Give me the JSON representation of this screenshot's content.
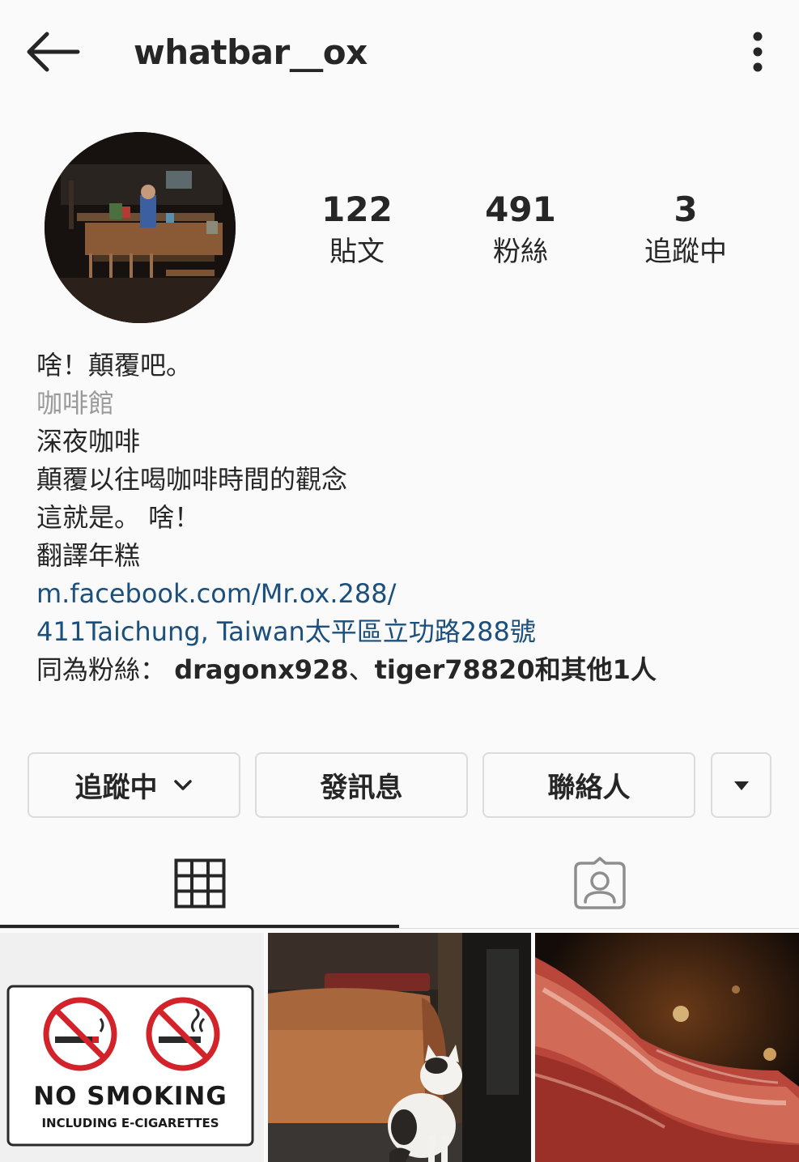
{
  "header": {
    "username": "whatbar__ox",
    "back_icon": "arrow-left-icon",
    "more_icon": "more-vertical-icon"
  },
  "stats": {
    "posts": {
      "value": "122",
      "label": "貼文"
    },
    "followers": {
      "value": "491",
      "label": "粉絲"
    },
    "following": {
      "value": "3",
      "label": "追蹤中"
    }
  },
  "bio": {
    "name": "啥！顛覆吧。",
    "category": "咖啡館",
    "lines": [
      "深夜咖啡",
      "顛覆以往喝咖啡時間的觀念",
      "這就是。 啥！"
    ],
    "translate": "翻譯年糕",
    "website": "m.facebook.com/Mr.ox.288/",
    "address": "411Taichung, Taiwan太平區立功路288號",
    "mutual_prefix": "同為粉絲：",
    "mutual_user1": "dragonx928",
    "mutual_sep": "、",
    "mutual_user2": "tiger78820",
    "mutual_suffix": "和其他1人"
  },
  "actions": {
    "following_label": "追蹤中",
    "message_label": "發訊息",
    "contact_label": "聯絡人"
  },
  "tabs": {
    "grid_icon": "grid-icon",
    "tagged_icon": "tagged-person-icon",
    "active": "grid"
  },
  "posts": {
    "post1": {
      "title": "NO SMOKING",
      "subtitle": "INCLUDING E-CIGARETTES"
    }
  },
  "colors": {
    "background": "#fafafa",
    "text": "#262626",
    "link": "#1a4f7e",
    "category": "#9a9a9a",
    "border": "#dbdbdb",
    "no_smoking_red": "#d2232a"
  }
}
